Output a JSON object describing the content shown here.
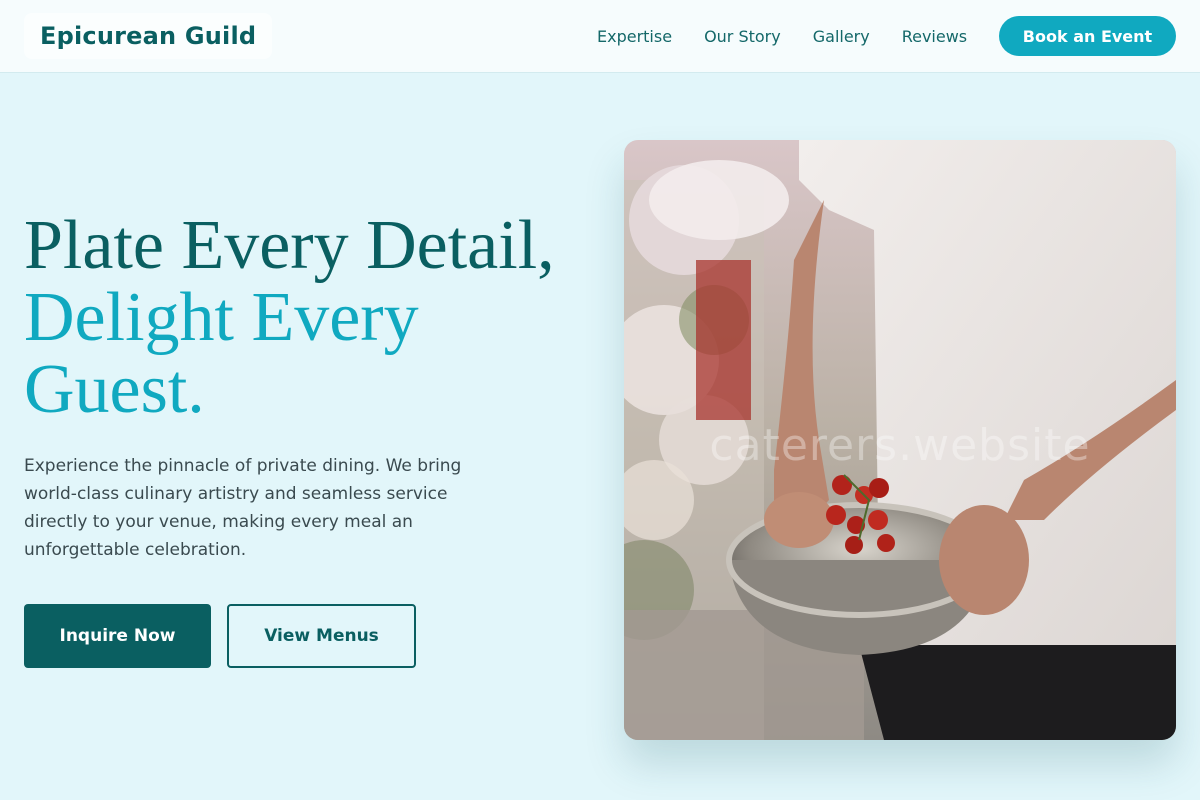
{
  "header": {
    "logo": "Epicurean Guild",
    "nav": [
      "Expertise",
      "Our Story",
      "Gallery",
      "Reviews"
    ],
    "cta": "Book an Event"
  },
  "hero": {
    "headline_line1": "Plate Every Detail,",
    "headline_line2": "Delight Every Guest.",
    "body": "Experience the pinnacle of private dining. We bring world-class culinary artistry and seamless service directly to your venue, making every meal an unforgettable celebration.",
    "primary_button": "Inquire Now",
    "secondary_button": "View Menus",
    "watermark": "caterers.website"
  },
  "colors": {
    "primary": "#0a5f61",
    "accent": "#10a9c0",
    "background": "#e2f6fa"
  }
}
